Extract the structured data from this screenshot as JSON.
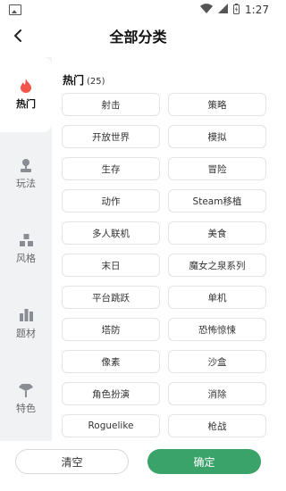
{
  "status_bar": {
    "time": "1:27"
  },
  "nav": {
    "title": "全部分类"
  },
  "sidebar": {
    "items": [
      {
        "label": "热门",
        "icon": "flame-icon",
        "active": true
      },
      {
        "label": "玩法",
        "icon": "joystick-icon",
        "active": false
      },
      {
        "label": "风格",
        "icon": "blocks-icon",
        "active": false
      },
      {
        "label": "题材",
        "icon": "bars-icon",
        "active": false
      },
      {
        "label": "特色",
        "icon": "fan-icon",
        "active": false
      }
    ]
  },
  "main": {
    "section_title": "热门",
    "section_count": "(25)",
    "tags": [
      "射击",
      "策略",
      "开放世界",
      "模拟",
      "生存",
      "冒险",
      "动作",
      "Steam移植",
      "多人联机",
      "美食",
      "末日",
      "魔女之泉系列",
      "平台跳跃",
      "单机",
      "塔防",
      "恐怖惊悚",
      "像素",
      "沙盒",
      "角色扮演",
      "消除",
      "Roguelike",
      "枪战"
    ]
  },
  "footer": {
    "clear_label": "清空",
    "confirm_label": "确定"
  },
  "colors": {
    "accent": "#3aa36a",
    "hot_icon": "#f2554a",
    "panel_bg": "#f1f2f4"
  }
}
